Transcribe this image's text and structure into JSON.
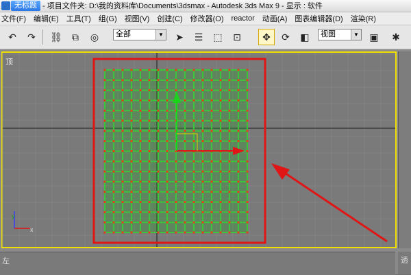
{
  "titlebar": {
    "tab": "无标题",
    "text": "- 项目文件夹: D:\\我的资料库\\Documents\\3dsmax    - Autodesk 3ds Max 9    - 显示 : 软件"
  },
  "menu": [
    "文件(F)",
    "编辑(E)",
    "工具(T)",
    "组(G)",
    "视图(V)",
    "创建(C)",
    "修改器(O)",
    "reactor",
    "动画(A)",
    "图表编辑器(D)",
    "渲染(R)"
  ],
  "toolbar": {
    "selection_filter": "全部",
    "reference_coord": "视图"
  },
  "viewports": {
    "top_label": "顶",
    "left_label": "左",
    "persp_label": "透"
  },
  "axes": {
    "x": "x",
    "y": "y"
  },
  "colors": {
    "accent": "#f0e000",
    "plane": "#3dc43d",
    "vertex": "#e63a1e",
    "annotation": "#e01515"
  }
}
